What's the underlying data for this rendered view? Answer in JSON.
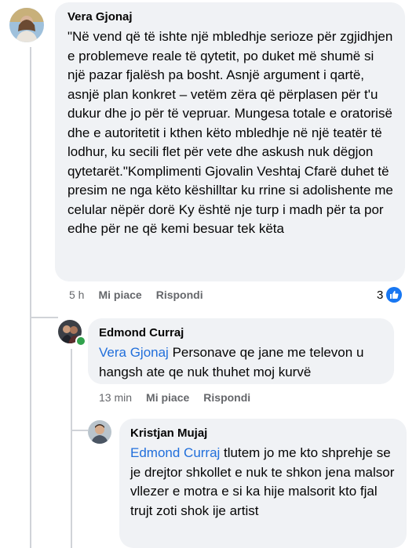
{
  "comments": [
    {
      "author": "Vera Gjonaj",
      "text": "\"Në vend që të ishte një mbledhje serioze për zgjidhjen e problemeve reale të qytetit, po duket më shumë si një pazar fjalësh pa bosht. Asnjë argument i qartë, asnjë plan konkret – vetëm zëra që përplasen për t'u dukur dhe jo për të vepruar. Mungesa totale e oratorisë dhe e autoritetit i kthen këto mbledhje në një teatër të lodhur, ku secili flet për vete dhe askush nuk dëgjon qytetarët.\"Komplimenti Gjovalin Veshtaj Cfarë duhet të presim ne nga këto këshilltar ku rrine si adolishente me celular nëpër dorë Ky është nje turp i madh për ta por edhe për ne që kemi besuar tek këta",
      "time": "5 h",
      "like_label": "Mi piace",
      "reply_label": "Rispondi",
      "reaction_count": "3"
    },
    {
      "author": "Edmond Curraj",
      "mention": "Vera Gjonaj",
      "text": " Personave qe jane me televon u hangsh ate qe nuk thuhet moj kurvë",
      "time": "13 min",
      "like_label": "Mi piace",
      "reply_label": "Rispondi"
    },
    {
      "author": "Kristjan Mujaj",
      "mention": "Edmond Curraj",
      "text": " tlutem jo me kto shprehje se je drejtor shkollet e nuk te shkon jena malsor vllezer e motra e si ka hije malsorit kto fjal trujt zoti shok ije artist"
    }
  ],
  "colors": {
    "link": "#216fdb",
    "bubble": "#f0f2f5",
    "meta": "#65676b",
    "like": "#1877f2"
  }
}
